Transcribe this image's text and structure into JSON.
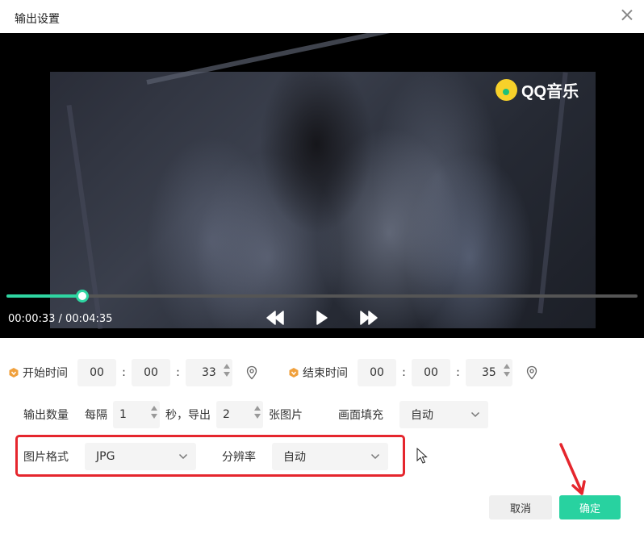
{
  "dialog": {
    "title": "输出设置"
  },
  "player": {
    "logo_text": "QQ音乐",
    "current_time": "00:00:33",
    "total_time": "00:04:35",
    "time_separator": " / ",
    "progress_fraction": 0.12,
    "accent_color": "#2fd6a2"
  },
  "start_time": {
    "label": "开始时间",
    "hh": "00",
    "mm": "00",
    "ss": "33"
  },
  "end_time": {
    "label": "结束时间",
    "hh": "00",
    "mm": "00",
    "ss": "35"
  },
  "output_count": {
    "label": "输出数量",
    "every_label": "每隔",
    "interval": "1",
    "sec_export_label": "秒，导出",
    "count": "2",
    "images_label": "张图片"
  },
  "fill": {
    "label": "画面填充",
    "value": "自动"
  },
  "format": {
    "label": "图片格式",
    "value": "JPG"
  },
  "resolution": {
    "label": "分辨率",
    "value": "自动"
  },
  "buttons": {
    "cancel": "取消",
    "confirm": "确定",
    "confirm_color": "#28d2a0"
  },
  "colon": ":",
  "icons": {
    "close": "close-icon",
    "rewind": "rewind-icon",
    "play": "play-icon",
    "fast_forward": "fast-forward-icon",
    "location": "location-pin-icon",
    "vip": "vip-badge-icon",
    "chevron": "chevron-down-icon"
  },
  "annotation_color": "#e5262d"
}
